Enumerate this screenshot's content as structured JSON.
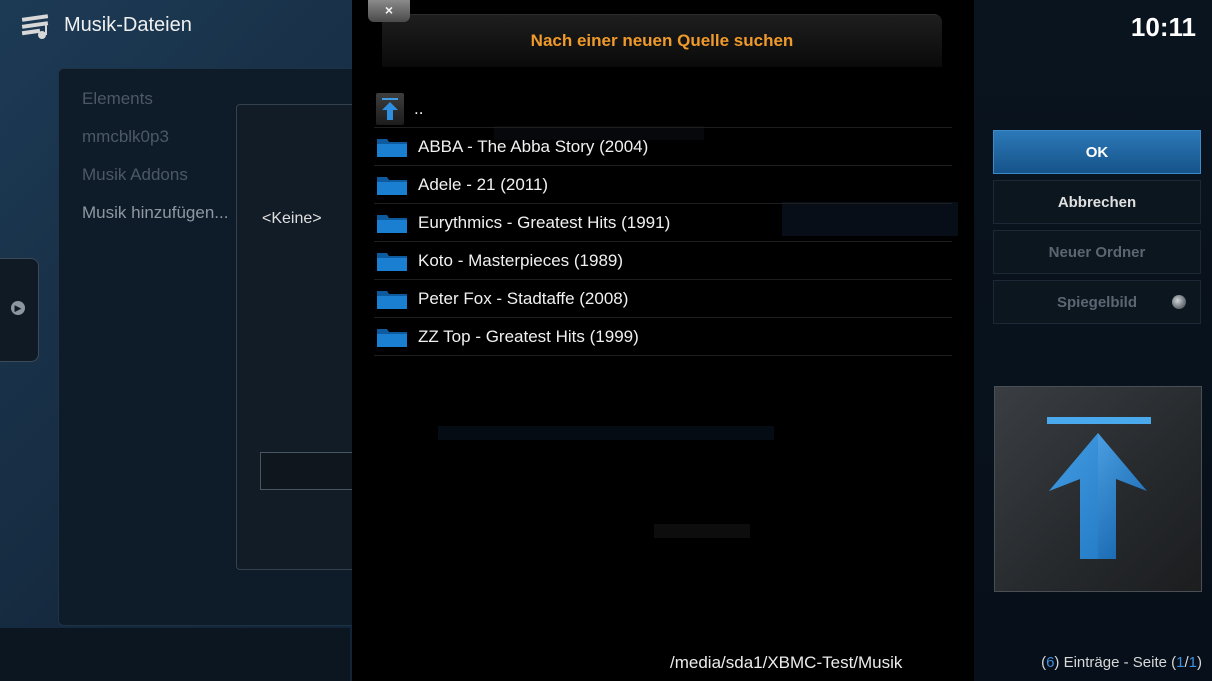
{
  "background": {
    "title": "Musik-Dateien",
    "list_items": [
      "Elements",
      "mmcblk0p3",
      "Musik Addons",
      "Musik hinzufügen..."
    ],
    "dialog_value": "<Keine>"
  },
  "dialog": {
    "close_label": "×",
    "title": "Nach einer neuen Quelle suchen",
    "parent_entry": "..",
    "folders": [
      "ABBA - The Abba Story (2004)",
      "Adele - 21 (2011)",
      "Eurythmics - Greatest Hits (1991)",
      "Koto - Masterpieces (1989)",
      "Peter Fox - Stadtaffe (2008)",
      "ZZ Top - Greatest Hits (1999)"
    ],
    "path": "/media/sda1/XBMC-Test/Musik"
  },
  "sidebar": {
    "clock": "10:11",
    "ok_label": "OK",
    "cancel_label": "Abbrechen",
    "new_folder_label": "Neuer Ordner",
    "mirror_label": "Spiegelbild",
    "items_count": "6",
    "items_text": ") Einträge - Seite (",
    "page_current": "1",
    "page_total": "1"
  },
  "colors": {
    "accent_title": "#ef9a2a",
    "ok_button": "#2c79b8",
    "highlight": "#3f8fe0"
  },
  "icons": [
    "music-files-icon",
    "folder-icon",
    "parent-folder-up-icon",
    "close-icon",
    "radio-icon"
  ]
}
